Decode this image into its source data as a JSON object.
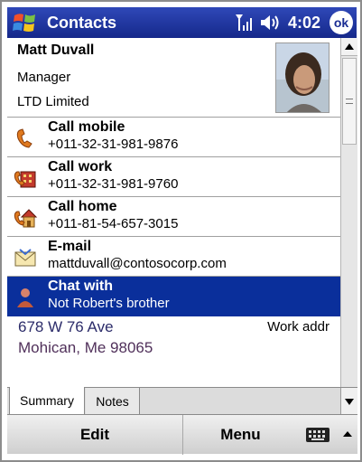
{
  "titlebar": {
    "app_title": "Contacts",
    "time": "4:02",
    "ok_label": "ok"
  },
  "contact": {
    "name": "Matt Duvall",
    "title": "Manager",
    "company": "LTD Limited"
  },
  "actions": [
    {
      "label": "Call mobile",
      "value": "+011-32-31-981-9876",
      "icon": "mobile-phone-icon"
    },
    {
      "label": "Call work",
      "value": "+011-32-31-981-9760",
      "icon": "work-phone-icon"
    },
    {
      "label": "Call home",
      "value": "+011-81-54-657-3015",
      "icon": "home-phone-icon"
    },
    {
      "label": "E-mail",
      "value": "mattduvall@contosocorp.com",
      "icon": "email-icon"
    },
    {
      "label": "Chat with",
      "value": "Not Robert's brother",
      "icon": "chat-icon",
      "selected": true
    }
  ],
  "address": {
    "line1": "678 W 76 Ave",
    "line2": "Mohican, Me 98065",
    "type": "Work addr"
  },
  "tabs": {
    "summary": "Summary",
    "notes": "Notes"
  },
  "softkeys": {
    "left": "Edit",
    "right": "Menu"
  },
  "colors": {
    "titlebar": "#1a2d93",
    "selection": "#0a2f9b"
  }
}
